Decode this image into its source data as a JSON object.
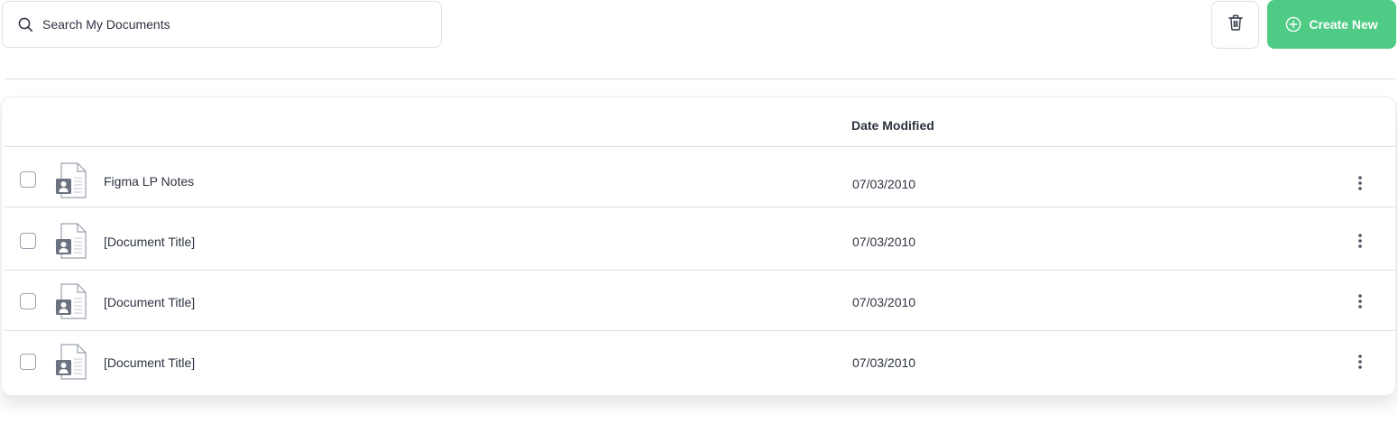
{
  "search": {
    "placeholder": "Search My Documents",
    "icon": "search-icon"
  },
  "toolbar": {
    "delete_icon": "trash-icon",
    "create_label": "Create New",
    "create_icon": "plus-circle-icon",
    "create_color": "#4ecb84"
  },
  "table": {
    "columns": {
      "date_modified": "Date Modified"
    },
    "rows": [
      {
        "title": "Figma LP Notes",
        "date": "07/03/2010",
        "icon": "document-icon"
      },
      {
        "title": "[Document Title]",
        "date": "07/03/2010",
        "icon": "document-icon"
      },
      {
        "title": "[Document Title]",
        "date": "07/03/2010",
        "icon": "document-icon"
      },
      {
        "title": "[Document Title]",
        "date": "07/03/2010",
        "icon": "document-icon"
      }
    ]
  }
}
